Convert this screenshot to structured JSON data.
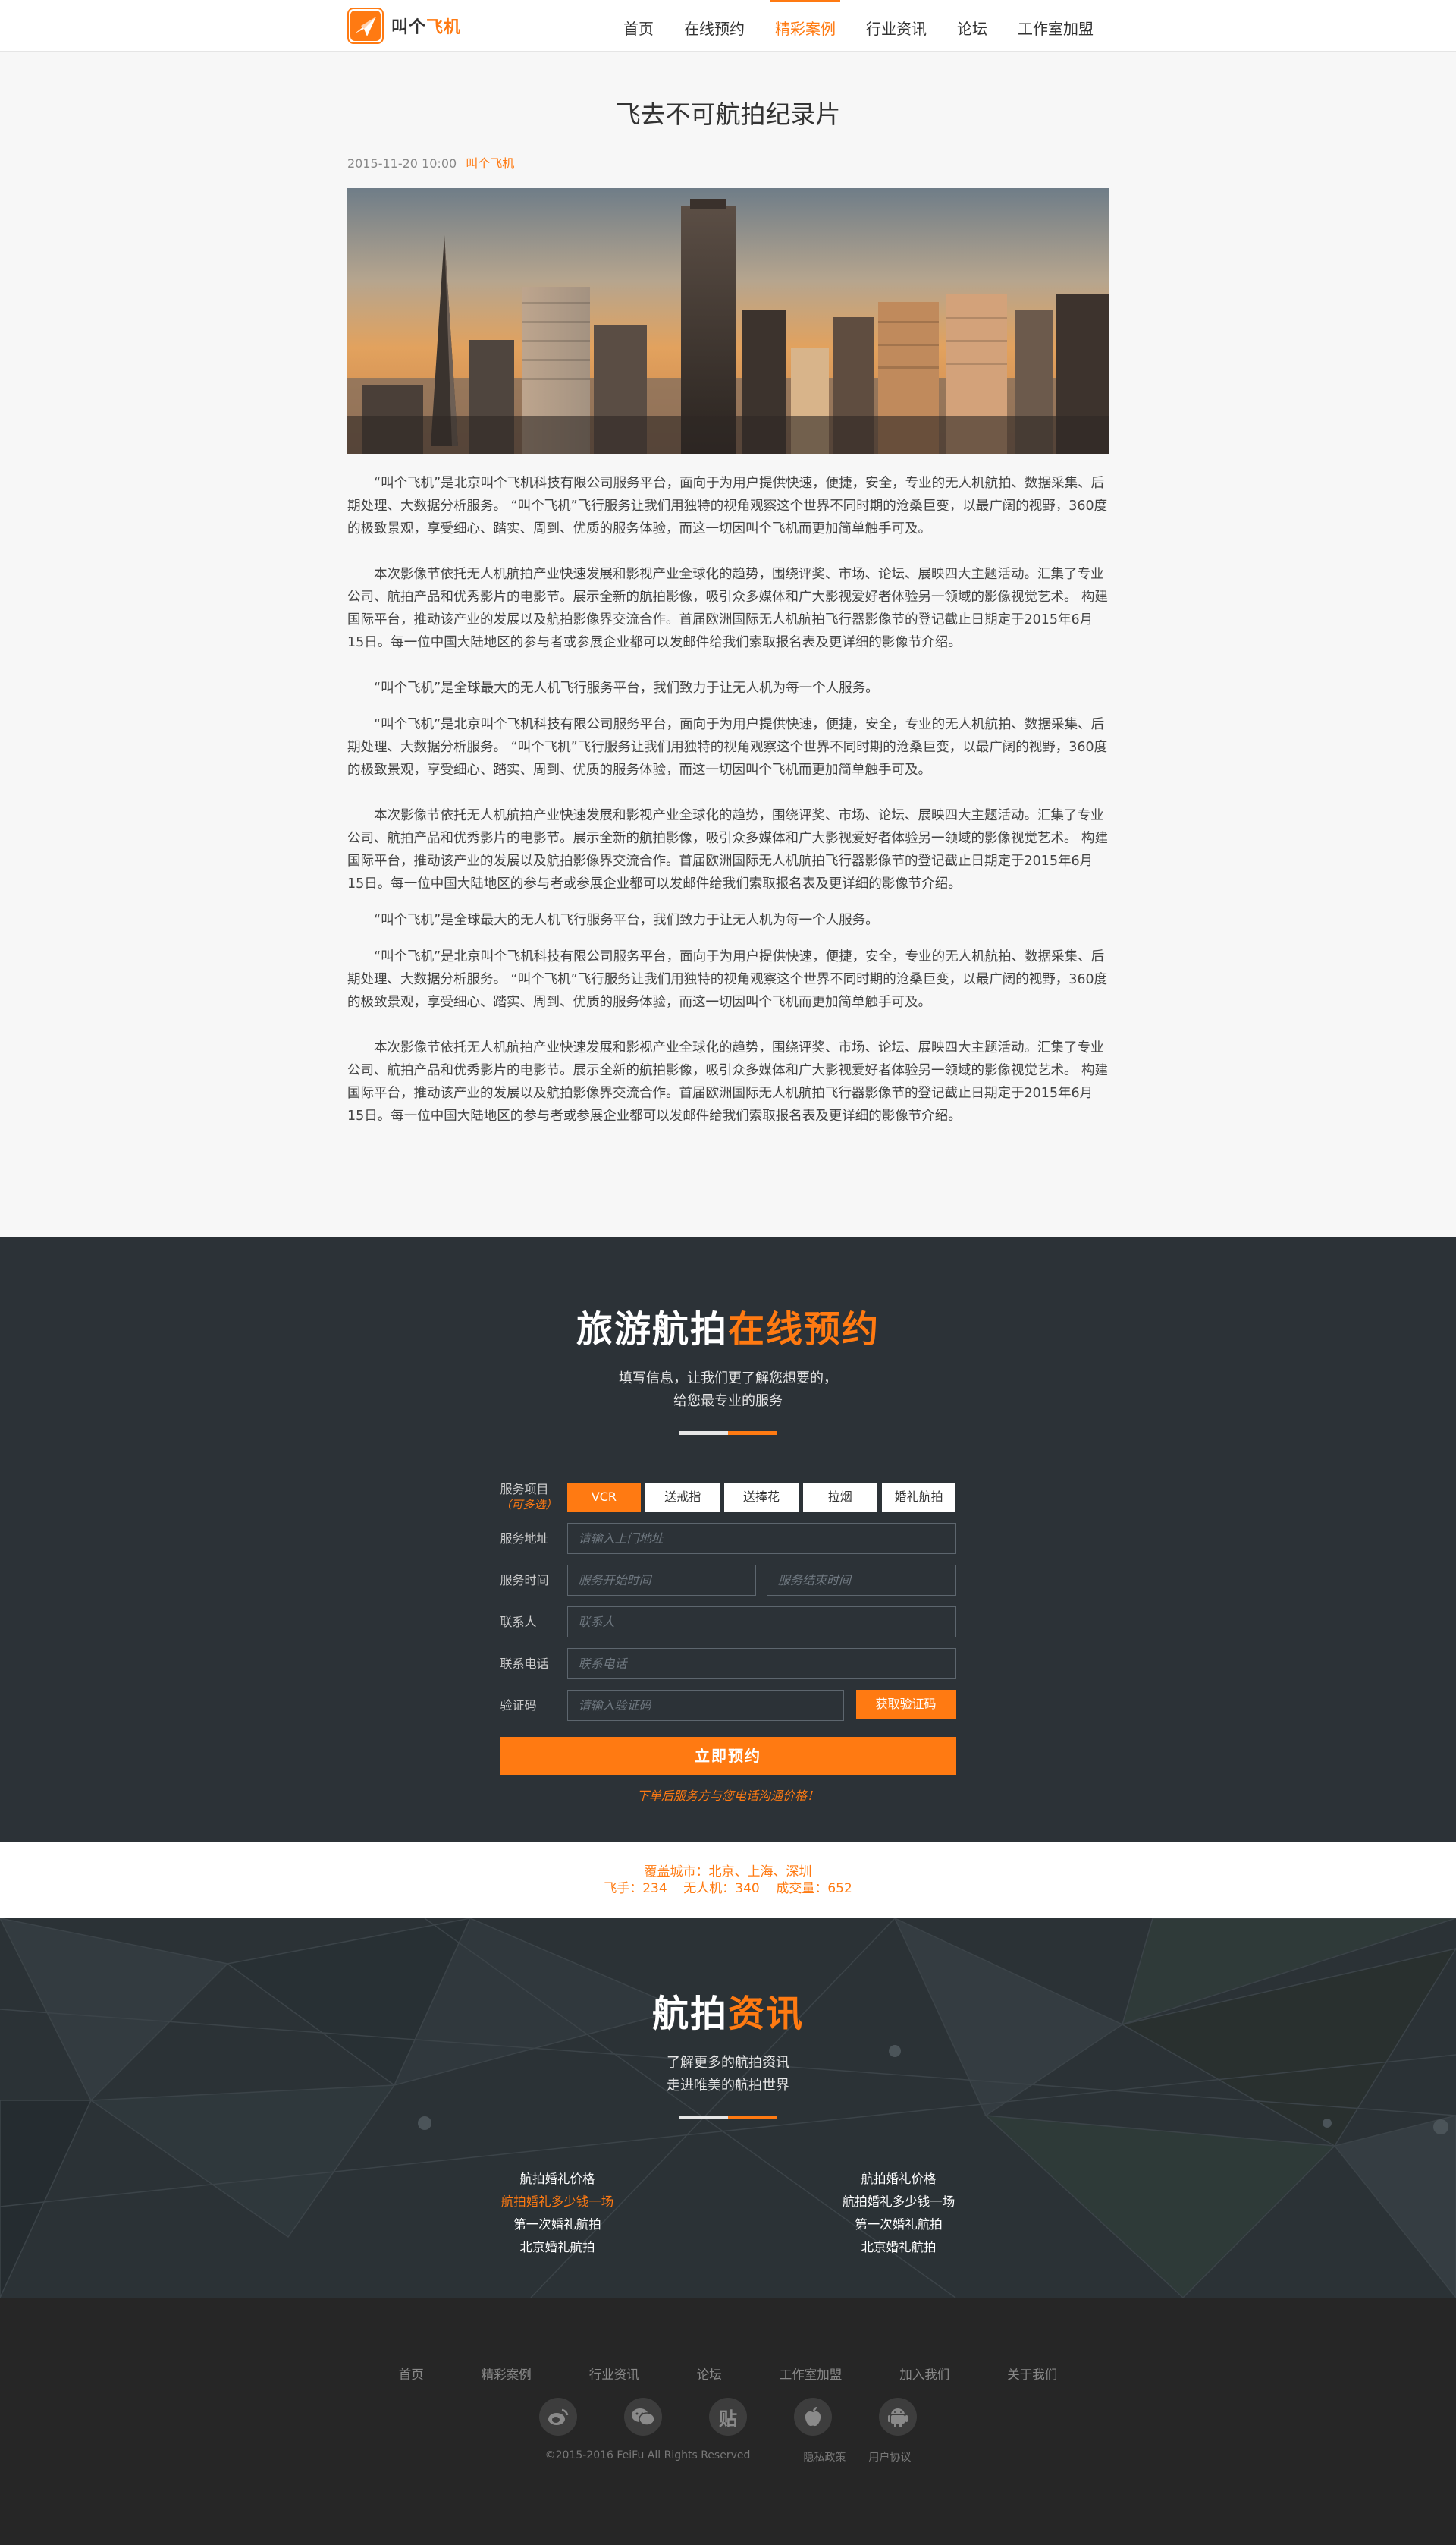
{
  "header": {
    "logo_text_a": "叫个",
    "logo_text_b": "飞机",
    "nav": [
      {
        "label": "首页"
      },
      {
        "label": "在线预约"
      },
      {
        "label": "精彩案例",
        "active": true
      },
      {
        "label": "行业资讯"
      },
      {
        "label": "论坛"
      },
      {
        "label": "工作室加盟"
      }
    ]
  },
  "article": {
    "title": "飞去不可航拍纪录片",
    "date": "2015-11-20 10:00",
    "author": "叫个飞机",
    "paragraphs": [
      "“叫个飞机”是北京叫个飞机科技有限公司服务平台，面向于为用户提供快速，便捷，安全，专业的无人机航拍、数据采集、后期处理、大数据分析服务。 “叫个飞机”飞行服务让我们用独特的视角观察这个世界不同时期的沧桑巨变，以最广阔的视野，360度的极致景观，享受细心、踏实、周到、优质的服务体验，而这一切因叫个飞机而更加简单触手可及。",
      "本次影像节依托无人机航拍产业快速发展和影视产业全球化的趋势，围绕评奖、市场、论坛、展映四大主题活动。汇集了专业公司、航拍产品和优秀影片的电影节。展示全新的航拍影像，吸引众多媒体和广大影视爱好者体验另一领域的影像视觉艺术。 构建国际平台，推动该产业的发展以及航拍影像界交流合作。首届欧洲国际无人机航拍飞行器影像节的登记截止日期定于2015年6月15日。每一位中国大陆地区的参与者或参展企业都可以发邮件给我们索取报名表及更详细的影像节介绍。",
      "“叫个飞机”是全球最大的无人机飞行服务平台，我们致力于让无人机为每一个人服务。",
      "“叫个飞机”是北京叫个飞机科技有限公司服务平台，面向于为用户提供快速，便捷，安全，专业的无人机航拍、数据采集、后期处理、大数据分析服务。 “叫个飞机”飞行服务让我们用独特的视角观察这个世界不同时期的沧桑巨变，以最广阔的视野，360度的极致景观，享受细心、踏实、周到、优质的服务体验，而这一切因叫个飞机而更加简单触手可及。",
      "本次影像节依托无人机航拍产业快速发展和影视产业全球化的趋势，围绕评奖、市场、论坛、展映四大主题活动。汇集了专业公司、航拍产品和优秀影片的电影节。展示全新的航拍影像，吸引众多媒体和广大影视爱好者体验另一领域的影像视觉艺术。 构建国际平台，推动该产业的发展以及航拍影像界交流合作。首届欧洲国际无人机航拍飞行器影像节的登记截止日期定于2015年6月15日。每一位中国大陆地区的参与者或参展企业都可以发邮件给我们索取报名表及更详细的影像节介绍。",
      "“叫个飞机”是全球最大的无人机飞行服务平台，我们致力于让无人机为每一个人服务。",
      "“叫个飞机”是北京叫个飞机科技有限公司服务平台，面向于为用户提供快速，便捷，安全，专业的无人机航拍、数据采集、后期处理、大数据分析服务。 “叫个飞机”飞行服务让我们用独特的视角观察这个世界不同时期的沧桑巨变，以最广阔的视野，360度的极致景观，享受细心、踏实、周到、优质的服务体验，而这一切因叫个飞机而更加简单触手可及。",
      "本次影像节依托无人机航拍产业快速发展和影视产业全球化的趋势，围绕评奖、市场、论坛、展映四大主题活动。汇集了专业公司、航拍产品和优秀影片的电影节。展示全新的航拍影像，吸引众多媒体和广大影视爱好者体验另一领域的影像视觉艺术。 构建国际平台，推动该产业的发展以及航拍影像界交流合作。首届欧洲国际无人机航拍飞行器影像节的登记截止日期定于2015年6月15日。每一位中国大陆地区的参与者或参展企业都可以发邮件给我们索取报名表及更详细的影像节介绍。"
    ]
  },
  "booking": {
    "title_a": "旅游航拍",
    "title_b": "在线预约",
    "sub_line1": "填写信息，让我们更了解您想要的，",
    "sub_line2": "给您最专业的服务",
    "service_label": "服务项目",
    "service_optional": "（可多选）",
    "services": [
      {
        "label": "VCR",
        "active": true
      },
      {
        "label": "送戒指"
      },
      {
        "label": "送捧花"
      },
      {
        "label": "拉烟"
      },
      {
        "label": "婚礼航拍"
      }
    ],
    "address_label": "服务地址",
    "address_placeholder": "请输入上门地址",
    "time_label": "服务时间",
    "time_start_placeholder": "服务开始时间",
    "time_end_placeholder": "服务结束时间",
    "contact_label": "联系人",
    "contact_placeholder": "联系人",
    "phone_label": "联系电话",
    "phone_placeholder": "联系电话",
    "code_label": "验证码",
    "code_placeholder": "请输入验证码",
    "code_button": "获取验证码",
    "submit": "立即预约",
    "note": "下单后服务方与您电话沟通价格！"
  },
  "stats": {
    "line1": "覆盖城市：北京、上海、深圳",
    "line2": "飞手：234    无人机：340    成交量：652"
  },
  "news": {
    "title_a": "航拍",
    "title_b": "资讯",
    "sub_line1": "了解更多的航拍资讯",
    "sub_line2": "走进唯美的航拍世界",
    "left": [
      "航拍婚礼价格",
      "航拍婚礼多少钱一场",
      "第一次婚礼航拍",
      "北京婚礼航拍"
    ],
    "right": [
      "航拍婚礼价格",
      "航拍婚礼多少钱一场",
      "第一次婚礼航拍",
      "北京婚礼航拍"
    ]
  },
  "footer": {
    "nav": [
      "首页",
      "精彩案例",
      "行业资讯",
      "论坛",
      "工作室加盟",
      "加入我们",
      "关于我们"
    ],
    "icons": [
      "weibo-icon",
      "wechat-icon",
      "tieba-icon",
      "apple-icon",
      "android-icon"
    ],
    "tieba_glyph": "贴",
    "copyright": "©2015-2016 FeiFu All Rights Reserved",
    "privacy": "隐私政策",
    "agreement": "用户协议"
  },
  "colors": {
    "accent": "#ff7a12",
    "dark": "#2c3237",
    "footer": "#262626"
  }
}
